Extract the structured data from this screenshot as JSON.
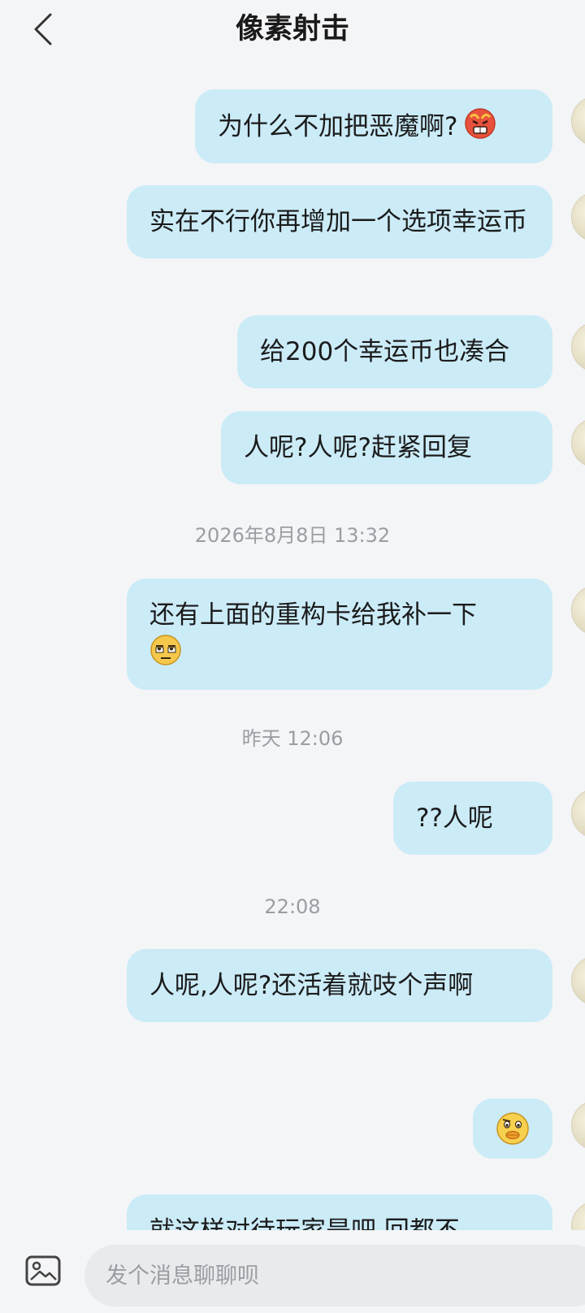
{
  "header": {
    "title": "像素射击"
  },
  "messages": [
    {
      "text": "为什么不加把恶魔啊?",
      "emoji": "angry-emoji"
    },
    {
      "text": "实在不行你再增加一个选项幸运币"
    },
    {
      "text": "给200个幸运币也凑合"
    },
    {
      "text": "人呢?人呢?赶紧回复"
    },
    {
      "text": "还有上面的重构卡给我补一下",
      "emoji": "eyeroll-emoji"
    },
    {
      "text": "??人呢"
    },
    {
      "text": "人呢,人呢?还活着就吱个声啊"
    },
    {
      "text": "",
      "emoji": "duck-face-emoji"
    },
    {
      "text": "就这样对待玩家是吧,回都不"
    }
  ],
  "timestamps": [
    "2026年8月8日 13:32",
    "昨天 12:06",
    "22:08"
  ],
  "input": {
    "placeholder": "发个消息聊聊呗",
    "value": ""
  },
  "icons": {
    "back": "back-chevron-icon",
    "image": "image-icon"
  },
  "colors": {
    "bubble": "#cbebf7",
    "background": "#f4f5f7"
  }
}
